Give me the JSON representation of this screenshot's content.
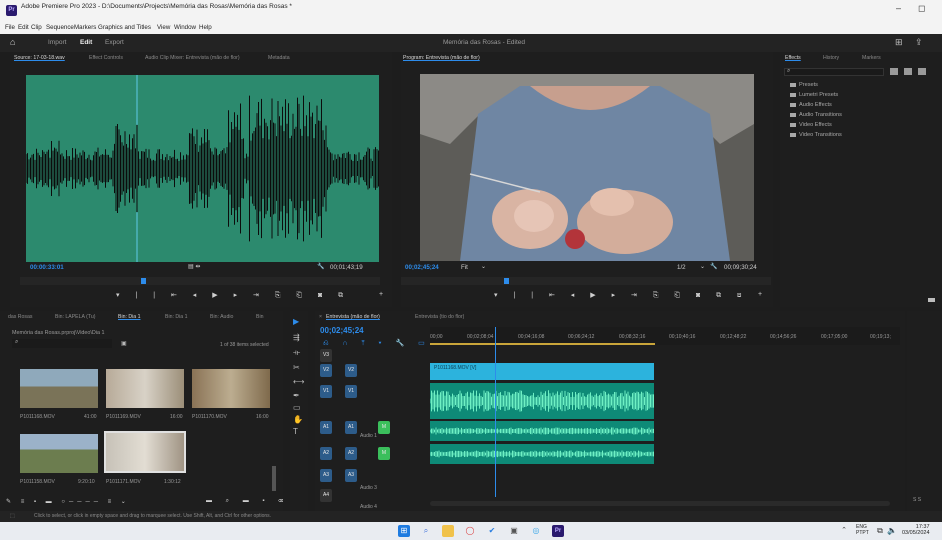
{
  "window": {
    "title": "Adobe Premiere Pro 2023 - D:\\Documents\\Projects\\Memória das Rosas\\Memória das Rosas *",
    "app_badge": "Pr",
    "minimize": "–",
    "maximize": "◻"
  },
  "menu": [
    "File",
    "Edit",
    "Clip",
    "Sequence",
    "Markers",
    "Graphics and Titles",
    "View",
    "Window",
    "Help"
  ],
  "workspace": {
    "tabs": [
      "Import",
      "Edit",
      "Export"
    ],
    "active": "Edit",
    "project_title": "Memória das Rosas  - Edited"
  },
  "source_panel": {
    "tabs": [
      "Source: 17-03-18.wav",
      "Effect Controls",
      "Audio Clip Mixer: Entrevista (mão de flor)",
      "Metadata"
    ],
    "timecode_in": "00:00:33:01",
    "timecode_out": "00;01;43;19"
  },
  "program_panel": {
    "tab": "Program: Entrevista (mão de flor)",
    "timecode": "00;02;45;24",
    "fit": "Fit",
    "resolution": "1/2",
    "duration": "00;09;30;24"
  },
  "effects_panel": {
    "tabs": [
      "Effects",
      "History",
      "Markers"
    ],
    "items": [
      "Presets",
      "Lumetri Presets",
      "Audio Effects",
      "Audio Transitions",
      "Video Effects",
      "Video Transitions"
    ]
  },
  "project_panel": {
    "tabs": [
      "das Rosas",
      "Bin: LAPELA (Tu)",
      "Bin: Dia 1",
      "Bin: Dia 1",
      "Bin: Audio",
      "Bin"
    ],
    "path": "Memória das Rosas.prproj\\Video\\Dia 1",
    "count": "1 of 38 items selected",
    "clips": [
      {
        "name": "P1011168.MOV",
        "dur": "41:00"
      },
      {
        "name": "P1011169.MOV",
        "dur": "16:00"
      },
      {
        "name": "P1011170.MOV",
        "dur": "16:00"
      },
      {
        "name": "P1011158.MOV",
        "dur": "9:20:10"
      },
      {
        "name": "P1011171.MOV",
        "dur": "1:30:12"
      }
    ]
  },
  "timeline": {
    "tabs": [
      "Entrevista (mão de flor)",
      "Entrevista (tio do flor)"
    ],
    "timecode": "00;02;45;24",
    "ruler": [
      "00;00",
      "00;02;08;04",
      "00;04;16;08",
      "00;06;24;12",
      "00;08;32;16",
      "00;10;40;16",
      "00;12;48;22",
      "00;14;56;26",
      "00;17;05;00",
      "00;19;13;"
    ],
    "tracks": [
      "V3",
      "V2",
      "V1",
      "A1",
      "A2",
      "A3",
      "A4"
    ],
    "track_labels": {
      "a1": "Audio 1",
      "a3": "Audio 3",
      "a4": "Audio 4"
    },
    "video_clip": "P1011168.MOV [V]"
  },
  "status": "Click to select, or click in empty space and drag to marquee select. Use Shift, Alt, and Ctrl for other options.",
  "taskbar": {
    "lang": "ENG",
    "region": "PTPT",
    "time": "17:37",
    "date": "03/05/2024"
  },
  "colors": {
    "accent": "#2d8ceb",
    "waveform_bg": "#2c8a6e",
    "video_clip": "#2cb3dd",
    "audio_clip": "#0e8a77"
  }
}
